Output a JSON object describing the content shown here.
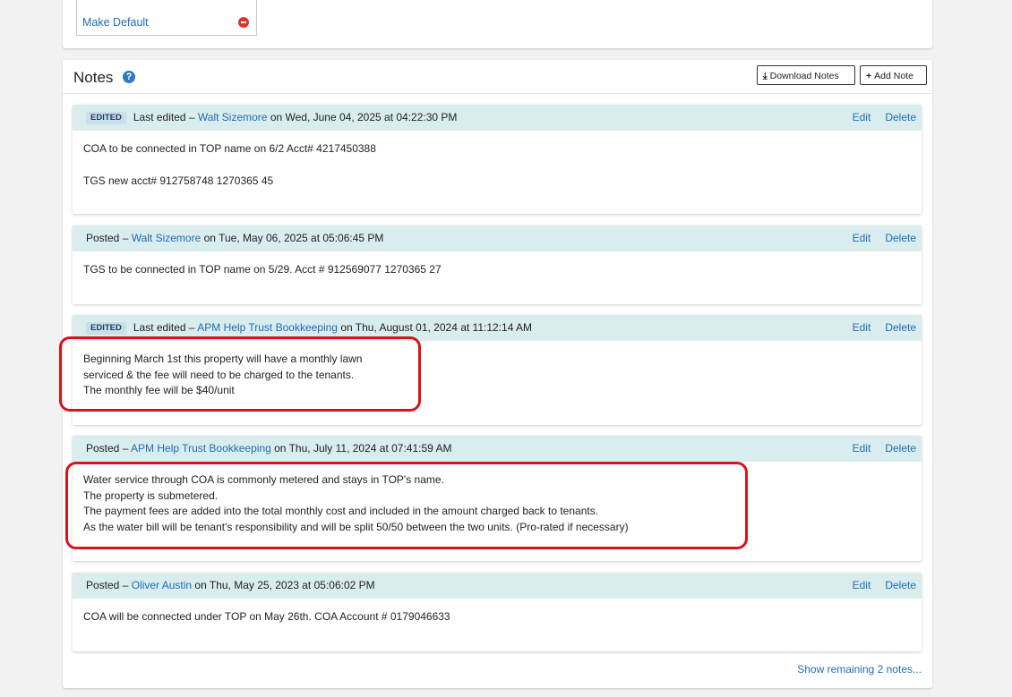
{
  "top": {
    "make_default_label": "Make Default"
  },
  "notes": {
    "title": "Notes",
    "help_icon": "question-circle-icon",
    "download_label": "Download Notes",
    "add_label": "Add Note",
    "edit_label": "Edit",
    "delete_label": "Delete",
    "show_more_label": "Show remaining 2 notes...",
    "items": [
      {
        "badge": "EDITED",
        "prefix": "Last edited – ",
        "author": "Walt Sizemore",
        "date": " on Wed, June 04, 2025 at 04:22:30 PM",
        "lines": [
          "COA to be connected in TOP name on 6/2 Acct# 4217450388",
          "",
          "TGS new acct# 912758748 1270365 45"
        ]
      },
      {
        "badge": "",
        "prefix": "Posted – ",
        "author": "Walt Sizemore",
        "date": " on Tue, May 06, 2025 at 05:06:45 PM",
        "lines": [
          "TGS to be connected in TOP name on 5/29. Acct # 912569077 1270365 27"
        ]
      },
      {
        "badge": "EDITED",
        "prefix": "Last edited – ",
        "author": "APM Help Trust Bookkeeping",
        "date": " on Thu, August 01, 2024 at 11:12:14 AM",
        "lines": [
          "Beginning March 1st this property will have a monthly lawn",
          "serviced & the fee will need to be charged to the tenants.",
          "The monthly fee will be $40/unit"
        ]
      },
      {
        "badge": "",
        "prefix": "Posted – ",
        "author": "APM Help Trust Bookkeeping",
        "date": " on Thu, July 11, 2024 at 07:41:59 AM",
        "lines": [
          "Water service through COA is commonly metered and stays in TOP's name.",
          "The property is submetered.",
          "The payment fees are added into the total monthly cost and included in the amount charged back to tenants.",
          "As the water bill will be tenant's responsibility and will be split 50/50 between the two units. (Pro-rated if necessary)"
        ]
      },
      {
        "badge": "",
        "prefix": "Posted – ",
        "author": "Oliver Austin",
        "date": " on Thu, May 25, 2023 at 05:06:02 PM",
        "lines": [
          "COA will be connected under TOP on May 26th. COA Account # 0179046633"
        ]
      }
    ]
  },
  "colors": {
    "accent": "#1f6db5",
    "note_header_bg": "#d9ecee",
    "highlight": "#d8141b"
  }
}
